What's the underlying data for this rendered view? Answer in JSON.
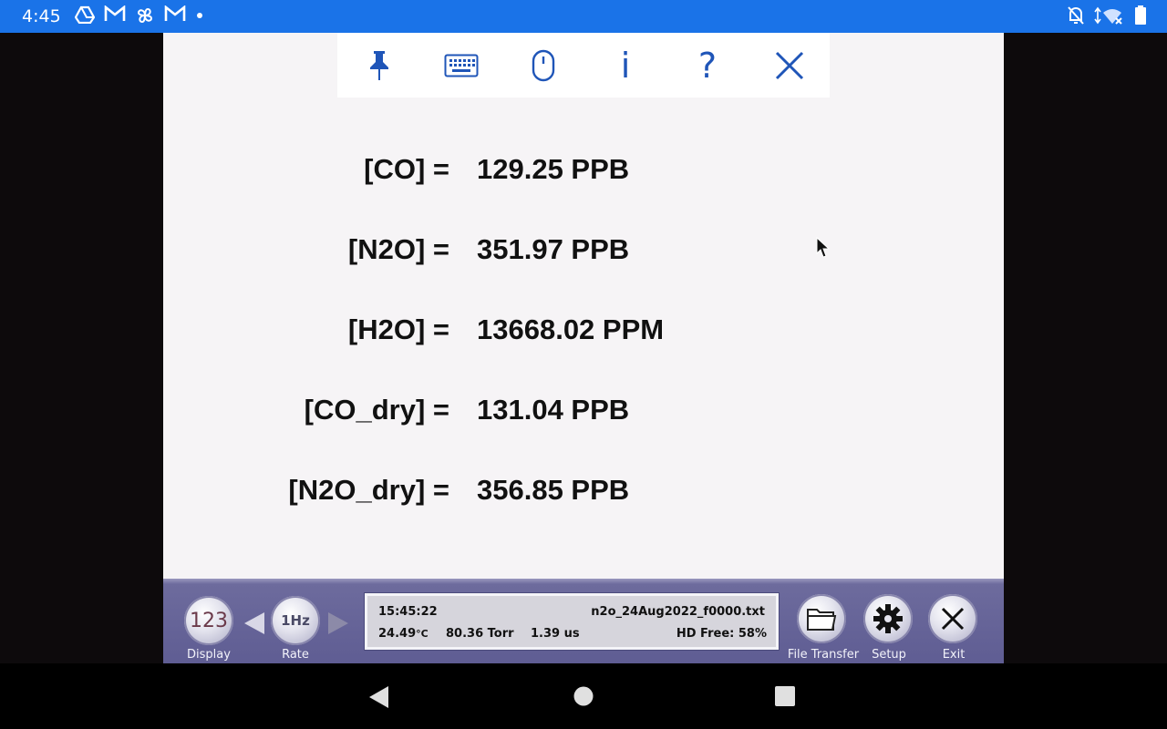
{
  "status_bar": {
    "time": "4:45",
    "left_icons": [
      "drive-icon",
      "gmail-icon",
      "pinwheel-icon",
      "gmail-icon",
      "dot-icon"
    ],
    "right_icons": [
      "bell-off-icon",
      "wifi-off-icon",
      "battery-icon"
    ]
  },
  "toolbar": {
    "items": [
      {
        "name": "pin-icon"
      },
      {
        "name": "keyboard-icon"
      },
      {
        "name": "mouse-icon"
      },
      {
        "name": "info-icon",
        "label": "i"
      },
      {
        "name": "help-icon",
        "label": "?"
      },
      {
        "name": "close-icon"
      }
    ]
  },
  "readings": [
    {
      "label": "[CO] =",
      "value": "129.25 PPB"
    },
    {
      "label": "[N2O] =",
      "value": "351.97 PPB"
    },
    {
      "label": "[H2O] =",
      "value": "13668.02 PPM"
    },
    {
      "label": "[CO_dry] =",
      "value": "131.04 PPB"
    },
    {
      "label": "[N2O_dry] =",
      "value": "356.85 PPB"
    }
  ],
  "bottom_panel": {
    "display_button": {
      "icon_text": "123",
      "label": "Display"
    },
    "rate_button": {
      "icon_text": "1Hz",
      "label": "Rate"
    },
    "info": {
      "time": "15:45:22",
      "filename": "n2o_24Aug2022_f0000.txt",
      "temperature": "24.49",
      "temperature_unit": "°C",
      "pressure": "80.36 Torr",
      "interval": "1.39 us",
      "disk": "HD Free: 58%"
    },
    "file_transfer_button": {
      "label": "File Transfer"
    },
    "setup_button": {
      "label": "Setup"
    },
    "exit_button": {
      "label": "Exit"
    }
  },
  "colors": {
    "status_bar": "#1a73e8",
    "toolbar_icon": "#1f55b8",
    "panel": "#5f5d93"
  }
}
